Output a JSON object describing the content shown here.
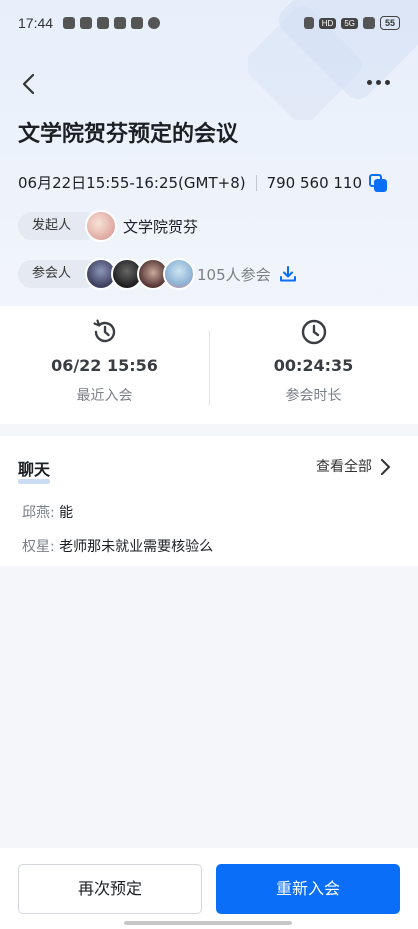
{
  "status_bar": {
    "time": "17:44",
    "hd_badge": "HD",
    "network": "5G",
    "battery": "55"
  },
  "meeting": {
    "title": "文学院贺芬预定的会议",
    "time_range": "06月22日15:55-16:25(GMT+8)",
    "meeting_id": "790 560 110"
  },
  "host": {
    "label": "发起人",
    "name": "文学院贺芬"
  },
  "participants": {
    "label": "参会人",
    "count_text": "105人参会"
  },
  "stats": {
    "recent_join_value": "06/22 15:56",
    "recent_join_label": "最近入会",
    "duration_value": "00:24:35",
    "duration_label": "参会时长"
  },
  "chat": {
    "title": "聊天",
    "view_all": "查看全部",
    "messages": [
      {
        "sender": "邱燕: ",
        "text": "能"
      },
      {
        "sender": "权星: ",
        "text": "老师那未就业需要核验么"
      }
    ]
  },
  "actions": {
    "reschedule_label": "再次预定",
    "rejoin_label": "重新入会"
  },
  "colors": {
    "accent": "#0a6ef8"
  }
}
